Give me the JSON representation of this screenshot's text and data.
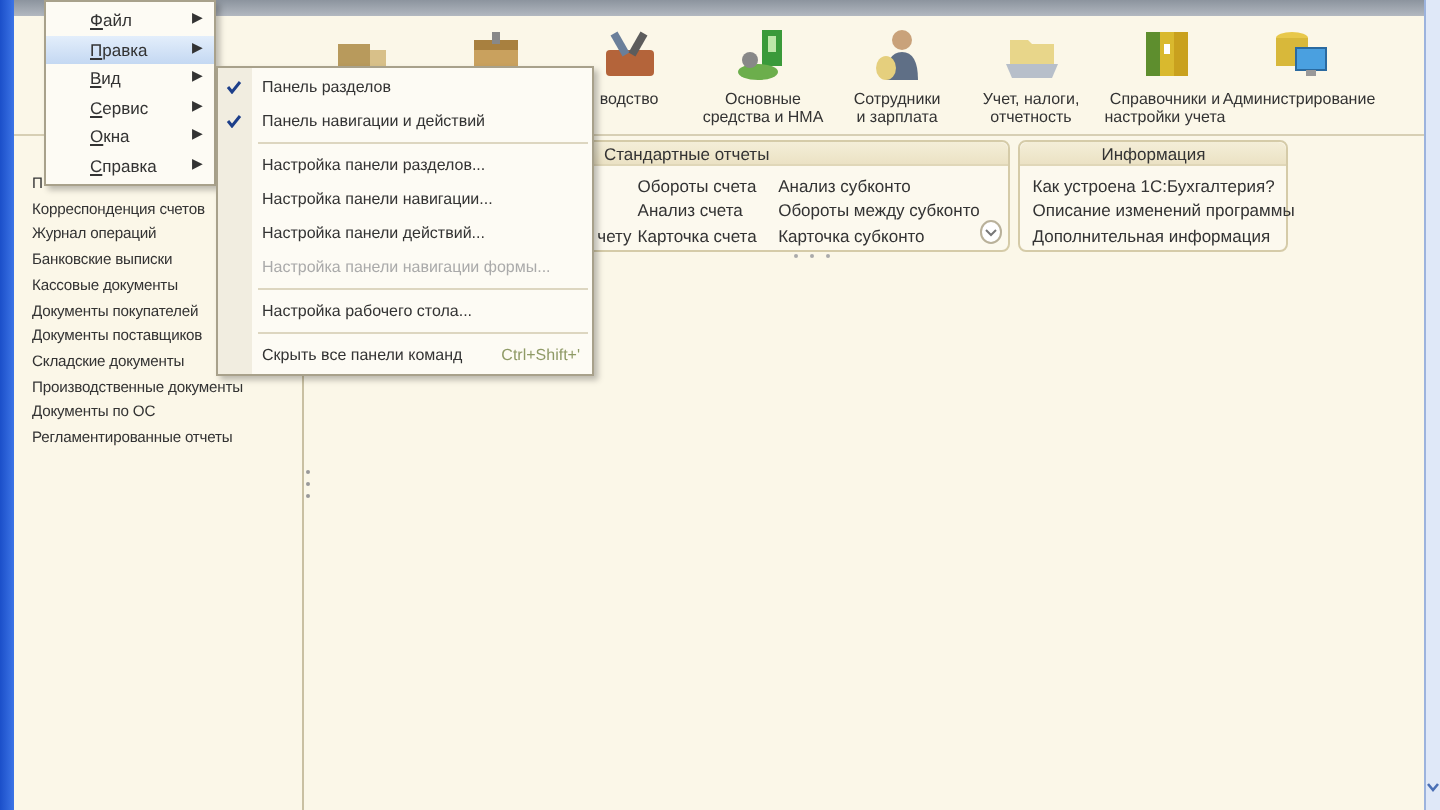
{
  "sections": [
    {
      "kind": "icon-only"
    },
    {
      "kind": "icon-only"
    },
    {
      "kind": "labeled",
      "label": "водство"
    },
    {
      "kind": "labeled",
      "label": "Основные\nсредства и НМА"
    },
    {
      "kind": "labeled",
      "label": "Сотрудники\nи зарплата"
    },
    {
      "kind": "labeled",
      "label": "Учет, налоги,\nотчетность"
    },
    {
      "kind": "labeled",
      "label": "Справочники и\nнастройки учета"
    },
    {
      "kind": "labeled",
      "label": "Администрирование"
    }
  ],
  "sidebar": {
    "items": [
      "П",
      "Корреспонденция счетов",
      "Журнал операций",
      "Банковские выписки",
      "Кассовые документы",
      "Документы покупателей",
      "Документы поставщиков",
      "Складские документы",
      "Производственные документы",
      "Документы по ОС",
      "Регламентированные отчеты"
    ]
  },
  "panels": [
    {
      "title": "Стандартные отчеты",
      "columns": [
        [
          "чету"
        ],
        [
          "Обороты счета",
          "Анализ счета",
          "Карточка счета"
        ],
        [
          "Анализ субконто",
          "Обороты между субконто",
          "Карточка субконто"
        ]
      ],
      "expand_button": true
    },
    {
      "title": "Информация",
      "columns": [
        [
          "Как устроена 1С:Бухгалтерия?",
          "Описание изменений программы",
          "Дополнительная информация"
        ]
      ],
      "expand_button": false
    }
  ],
  "menu": {
    "items": [
      {
        "label": "Файл",
        "arrow": "▶",
        "selected": false
      },
      {
        "label": "Правка",
        "arrow": "▶",
        "selected": true
      },
      {
        "label": "Вид",
        "arrow": "▶",
        "selected": false
      },
      {
        "label": "Сервис",
        "arrow": "▶",
        "selected": false
      },
      {
        "label": "Окна",
        "arrow": "▶",
        "selected": false
      },
      {
        "label": "Справка",
        "arrow": "▶",
        "selected": false
      }
    ]
  },
  "submenu": {
    "items": [
      {
        "kind": "check",
        "label": "Панель разделов",
        "checked": true
      },
      {
        "kind": "check",
        "label": "Панель навигации и действий",
        "checked": true
      },
      {
        "kind": "separator"
      },
      {
        "kind": "item",
        "label": "Настройка панели разделов...",
        "disabled": false
      },
      {
        "kind": "item",
        "label": "Настройка панели навигации...",
        "disabled": false
      },
      {
        "kind": "item",
        "label": "Настройка панели действий...",
        "disabled": false
      },
      {
        "kind": "item",
        "label": "Настройка панели навигации формы...",
        "disabled": true
      },
      {
        "kind": "separator"
      },
      {
        "kind": "item",
        "label": "Настройка рабочего стола...",
        "disabled": false
      },
      {
        "kind": "separator"
      },
      {
        "kind": "item",
        "label": "Скрыть все панели команд",
        "shortcut": "Ctrl+Shift+'",
        "disabled": false
      }
    ]
  }
}
